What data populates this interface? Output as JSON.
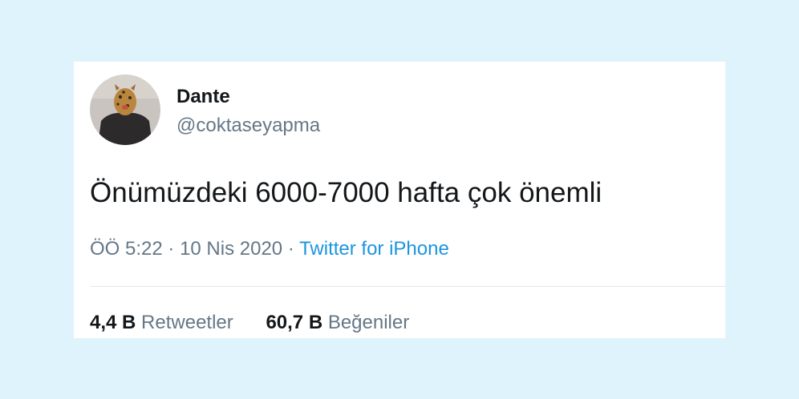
{
  "tweet": {
    "author": {
      "display_name": "Dante",
      "handle": "@coktaseyapma"
    },
    "text": "Önümüzdeki 6000-7000 hafta çok önemli",
    "time": "ÖÖ 5:22",
    "date": "10 Nis 2020",
    "separator": "·",
    "source": "Twitter for iPhone",
    "stats": {
      "retweets_count": "4,4 B",
      "retweets_label": "Retweetler",
      "likes_count": "60,7 B",
      "likes_label": "Beğeniler"
    }
  },
  "colors": {
    "background": "#dff3fd",
    "card": "#ffffff",
    "text_primary": "#14171a",
    "text_secondary": "#657786",
    "link": "#1b95e0",
    "divider": "#e1e8ed"
  }
}
